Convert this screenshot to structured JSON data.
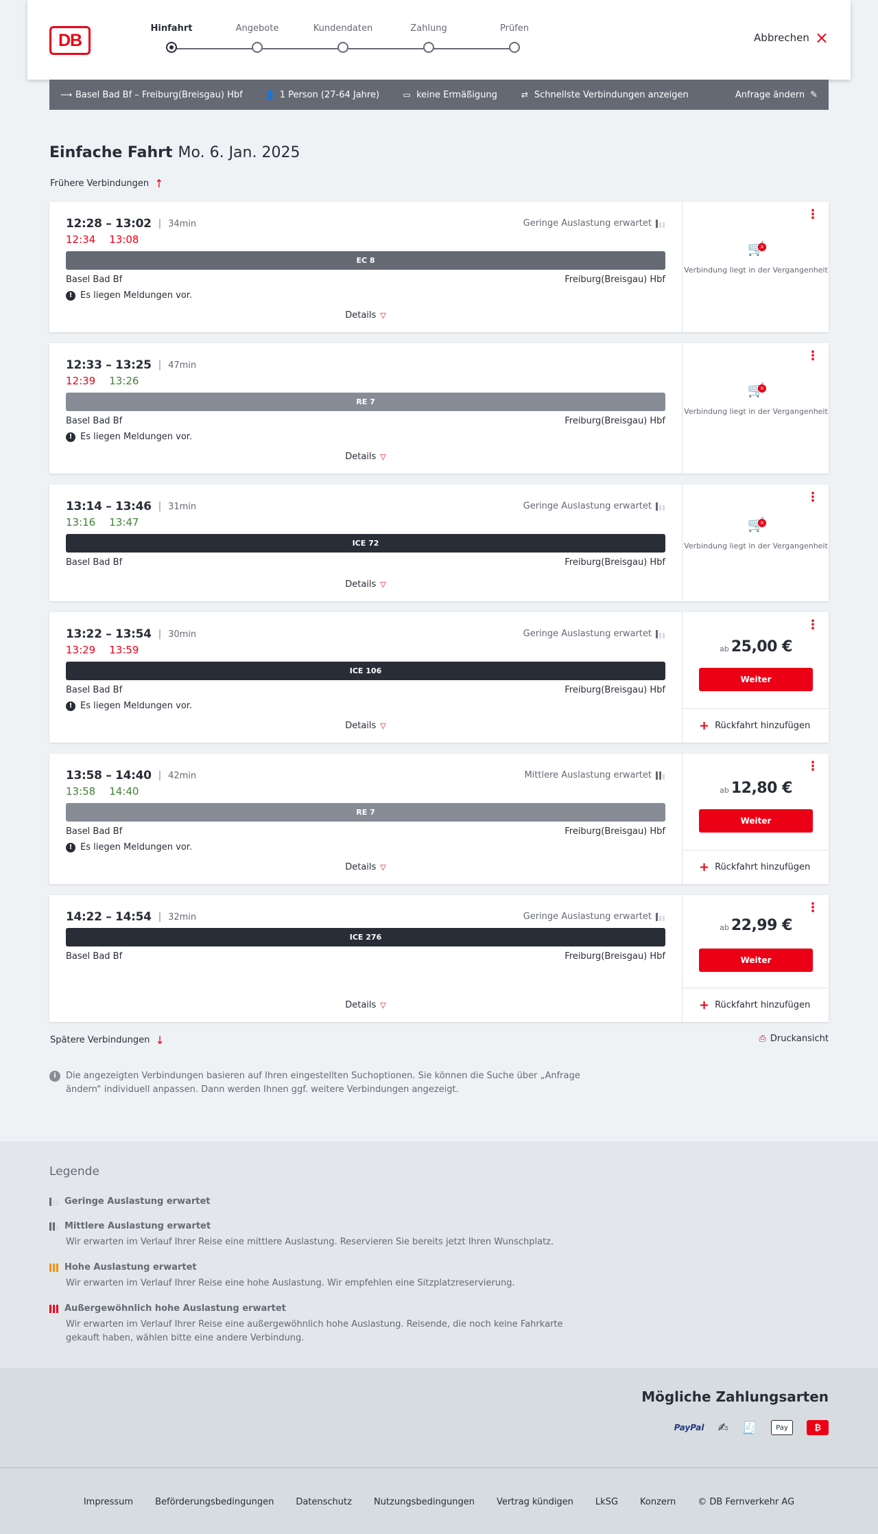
{
  "header": {
    "logo_text": "DB",
    "steps": [
      {
        "label": "Hinfahrt",
        "active": true
      },
      {
        "label": "Angebote",
        "active": false
      },
      {
        "label": "Kundendaten",
        "active": false
      },
      {
        "label": "Zahlung",
        "active": false
      },
      {
        "label": "Prüfen",
        "active": false
      }
    ],
    "cancel_label": "Abbrechen"
  },
  "search": {
    "route": "Basel Bad Bf – Freiburg(Breisgau) Hbf",
    "passengers": "1 Person (27-64 Jahre)",
    "discount": "keine Ermäßigung",
    "fastest": "Schnellste Verbindungen anzeigen",
    "change": "Anfrage ändern"
  },
  "page": {
    "title_bold": "Einfache Fahrt",
    "date": "Mo. 6. Jan. 2025",
    "earlier": "Frühere Verbindungen",
    "later": "Spätere Verbindungen",
    "print": "Druckansicht",
    "info": "Die angezeigten Verbindungen basieren auf Ihren eingestellten Suchoptionen. Sie können die Suche über „Anfrage ändern“ individuell anpassen. Dann werden Ihnen ggf. weitere Verbindungen angezeigt."
  },
  "connections": [
    {
      "times": "12:28 – 13:02",
      "duration": "34min",
      "load": "Geringe Auslastung erwartet",
      "load_level": 1,
      "rt_dep": "12:34",
      "rt_dep_status": "late",
      "rt_arr": "13:08",
      "rt_arr_status": "late",
      "train": "EC 8",
      "train_type": "ec",
      "from": "Basel Bad Bf",
      "to": "Freiburg(Breisgau) Hbf",
      "message": "Es liegen Meldungen vor.",
      "details": "Details",
      "past_text": "Verbindung liegt in der Vergangenheit"
    },
    {
      "times": "12:33 – 13:25",
      "duration": "47min",
      "load": "",
      "load_level": 0,
      "rt_dep": "12:39",
      "rt_dep_status": "late",
      "rt_arr": "13:26",
      "rt_arr_status": "ontime",
      "train": "RE 7",
      "train_type": "re",
      "from": "Basel Bad Bf",
      "to": "Freiburg(Breisgau) Hbf",
      "message": "Es liegen Meldungen vor.",
      "details": "Details",
      "past_text": "Verbindung liegt in der Vergangenheit"
    },
    {
      "times": "13:14 – 13:46",
      "duration": "31min",
      "load": "Geringe Auslastung erwartet",
      "load_level": 1,
      "rt_dep": "13:16",
      "rt_dep_status": "ontime",
      "rt_arr": "13:47",
      "rt_arr_status": "ontime",
      "train": "ICE 72",
      "train_type": "ice",
      "from": "Basel Bad Bf",
      "to": "Freiburg(Breisgau) Hbf",
      "message": "",
      "details": "Details",
      "past_text": "Verbindung liegt in der Vergangenheit"
    },
    {
      "times": "13:22 – 13:54",
      "duration": "30min",
      "load": "Geringe Auslastung erwartet",
      "load_level": 1,
      "rt_dep": "13:29",
      "rt_dep_status": "late",
      "rt_arr": "13:59",
      "rt_arr_status": "late",
      "train": "ICE 106",
      "train_type": "ice",
      "from": "Basel Bad Bf",
      "to": "Freiburg(Breisgau) Hbf",
      "message": "Es liegen Meldungen vor.",
      "details": "Details",
      "price_prefix": "ab",
      "price": "25,00 €",
      "button": "Weiter",
      "return_label": "Rückfahrt hinzufügen"
    },
    {
      "times": "13:58 – 14:40",
      "duration": "42min",
      "load": "Mittlere Auslastung erwartet",
      "load_level": 2,
      "rt_dep": "13:58",
      "rt_dep_status": "ontime",
      "rt_arr": "14:40",
      "rt_arr_status": "ontime",
      "train": "RE 7",
      "train_type": "re",
      "from": "Basel Bad Bf",
      "to": "Freiburg(Breisgau) Hbf",
      "message": "Es liegen Meldungen vor.",
      "details": "Details",
      "price_prefix": "ab",
      "price": "12,80 €",
      "button": "Weiter",
      "return_label": "Rückfahrt hinzufügen"
    },
    {
      "times": "14:22 – 14:54",
      "duration": "32min",
      "load": "Geringe Auslastung erwartet",
      "load_level": 1,
      "rt_dep": "",
      "rt_arr": "",
      "train": "ICE 276",
      "train_type": "ice",
      "from": "Basel Bad Bf",
      "to": "Freiburg(Breisgau) Hbf",
      "message": "",
      "details": "Details",
      "price_prefix": "ab",
      "price": "22,99 €",
      "button": "Weiter",
      "return_label": "Rückfahrt hinzufügen"
    }
  ],
  "legend": {
    "title": "Legende",
    "items": [
      {
        "title": "Geringe Auslastung erwartet",
        "desc": ""
      },
      {
        "title": "Mittlere Auslastung erwartet",
        "desc": "Wir erwarten im Verlauf Ihrer Reise eine mittlere Auslastung. Reservieren Sie bereits jetzt Ihren Wunschplatz."
      },
      {
        "title": "Hohe Auslastung erwartet",
        "desc": "Wir erwarten im Verlauf Ihrer Reise eine hohe Auslastung. Wir empfehlen eine Sitzplatzreservierung."
      },
      {
        "title": "Außergewöhnlich hohe Auslastung erwartet",
        "desc": "Wir erwarten im Verlauf Ihrer Reise eine außergewöhnlich hohe Auslastung. Reisende, die noch keine Fahrkarte gekauft haben, wählen bitte eine andere Verbindung."
      }
    ]
  },
  "payment": {
    "title": "Mögliche Zahlungsarten",
    "paypal": "PayPal",
    "applepay": "Pay"
  },
  "footer": {
    "links": [
      "Impressum",
      "Beförderungsbedingungen",
      "Datenschutz",
      "Nutzungsbedingungen",
      "Vertrag kündigen",
      "LkSG",
      "Konzern",
      "© DB Fernverkehr AG"
    ]
  },
  "colors": {
    "brand": "#ec0016",
    "late": "#ec0016",
    "ontime": "#408335",
    "dark": "#282d37"
  }
}
